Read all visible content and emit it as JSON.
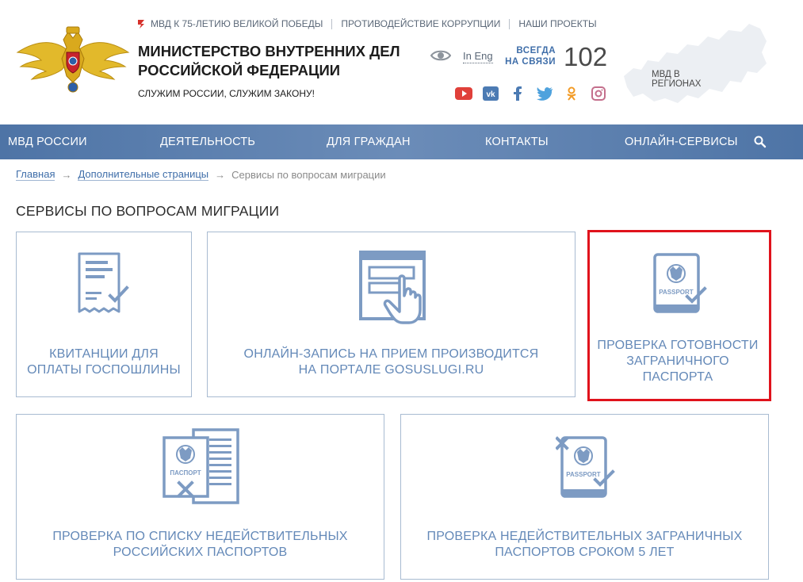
{
  "header": {
    "top_links": [
      "МВД К 75-ЛЕТИЮ ВЕЛИКОЙ ПОБЕДЫ",
      "ПРОТИВОДЕЙСТВИЕ КОРРУПЦИИ",
      "НАШИ ПРОЕКТЫ"
    ],
    "ministry_line1": "МИНИСТЕРСТВО ВНУТРЕННИХ ДЕЛ",
    "ministry_line2": "РОССИЙСКОЙ ФЕДЕРАЦИИ",
    "motto": "СЛУЖИМ РОССИИ, СЛУЖИМ ЗАКОНУ!",
    "lang_link": "In Eng",
    "always_line1": "ВСЕГДА",
    "always_line2": "НА СВЯЗИ",
    "hotline": "102",
    "region_label": "МВД В РЕГИОНАХ",
    "socials": [
      "youtube-icon",
      "vk-icon",
      "facebook-icon",
      "twitter-icon",
      "odnoklassniki-icon",
      "instagram-icon"
    ]
  },
  "nav": {
    "items": [
      "МВД РОССИИ",
      "ДЕЯТЕЛЬНОСТЬ",
      "ДЛЯ ГРАЖДАН",
      "КОНТАКТЫ",
      "ОНЛАЙН-СЕРВИСЫ"
    ]
  },
  "breadcrumb": {
    "home": "Главная",
    "extra": "Дополнительные страницы",
    "current": "Сервисы по вопросам миграции",
    "arrow": "→"
  },
  "page_title": "СЕРВИСЫ ПО ВОПРОСАМ МИГРАЦИИ",
  "cards": [
    {
      "line1": "КВИТАНЦИИ ДЛЯ",
      "line2": "ОПЛАТЫ ГОСПОШЛИНЫ"
    },
    {
      "line1": "ОНЛАЙН-ЗАПИСЬ НА ПРИЕМ ПРОИЗВОДИТСЯ",
      "line2": "НА ПОРТАЛЕ GOSUSLUGI.RU"
    },
    {
      "line1": "ПРОВЕРКА ГОТОВНОСТИ",
      "line2": "ЗАГРАНИЧНОГО",
      "line3": "ПАСПОРТА",
      "icon_text": "PASSPORT"
    },
    {
      "line1": "ПРОВЕРКА ПО СПИСКУ НЕДЕЙСТВИТЕЛЬНЫХ",
      "line2": "РОССИЙСКИХ ПАСПОРТОВ",
      "icon_text": "ПАСПОРТ"
    },
    {
      "line1": "ПРОВЕРКА НЕДЕЙСТВИТЕЛЬНЫХ ЗАГРАНИЧНЫХ",
      "line2": "ПАСПОРТОВ СРОКОМ 5 ЛЕТ",
      "icon_text": "PASSPORT"
    }
  ],
  "colors": {
    "nav_bg": "#4e74a6",
    "accent_blue": "#6489b8",
    "card_border": "#a8bbd1",
    "highlight_red": "#e0131c"
  }
}
